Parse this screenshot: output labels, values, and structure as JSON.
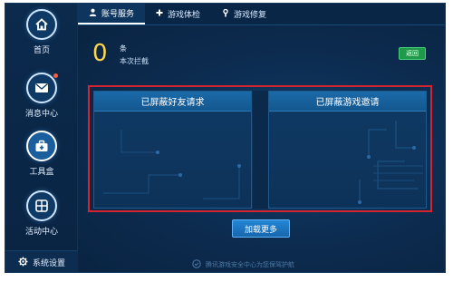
{
  "sidebar": {
    "items": [
      {
        "label": "首页",
        "icon": "home-icon"
      },
      {
        "label": "消息中心",
        "icon": "mail-icon"
      },
      {
        "label": "工具盒",
        "icon": "toolbox-icon"
      },
      {
        "label": "活动中心",
        "icon": "activity-icon"
      }
    ],
    "settings_label": "系统设置"
  },
  "tabs": [
    {
      "label": "账号服务",
      "icon": "user-icon"
    },
    {
      "label": "游戏体检",
      "icon": "plus-icon"
    },
    {
      "label": "游戏修复",
      "icon": "repair-icon"
    }
  ],
  "summary": {
    "count": "0",
    "unit": "条",
    "caption": "本次拦截",
    "back_label": "返回"
  },
  "panels": {
    "left_title": "已屏蔽好友请求",
    "right_title": "已屏蔽游戏邀请"
  },
  "load_more_label": "加载更多",
  "footer_text": "腾讯游戏安全中心为您保驾护航",
  "colors": {
    "accent": "#1b74c5",
    "highlight_frame": "#d3242f",
    "count": "#ffd54a",
    "back_button": "#1f9a4a"
  }
}
